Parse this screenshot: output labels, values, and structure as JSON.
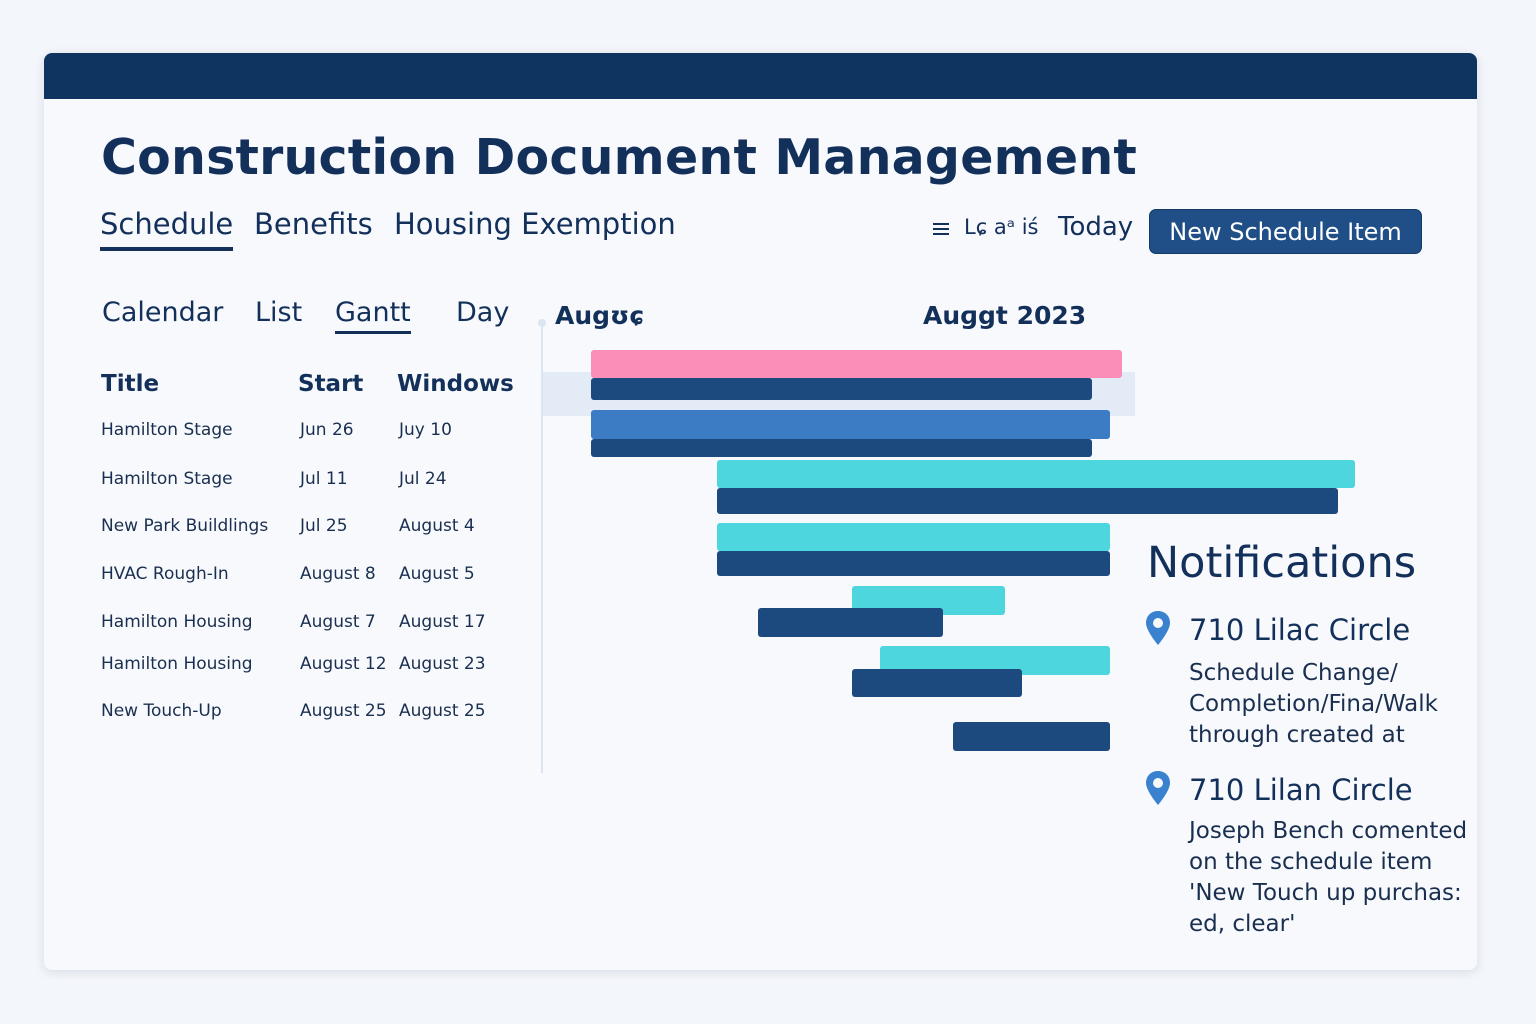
{
  "app": {
    "title": "Construction Document Management",
    "colors": {
      "header": "#0f3460",
      "accent": "#1f4f86",
      "pink": "#fb8eb8",
      "blue": "#3b7cc4",
      "cyan": "#4dd6de",
      "navy": "#1d4a7e"
    }
  },
  "main_tabs": [
    {
      "label": "Schedule",
      "active": true
    },
    {
      "label": "Benefits",
      "active": false
    },
    {
      "label": "Housing Exemption",
      "active": false
    }
  ],
  "toolbar": {
    "list_icon": "list-icon",
    "legend_label": "Lɕ aᵃ iś",
    "today_label": "Today",
    "new_item_label": "New Schedule Item"
  },
  "view_tabs": [
    {
      "label": "Calendar",
      "active": false
    },
    {
      "label": "List",
      "active": false
    },
    {
      "label": "Gantt",
      "active": true
    },
    {
      "label": "Day",
      "active": false
    }
  ],
  "table": {
    "columns": [
      "Title",
      "Start",
      "Windows"
    ],
    "rows": [
      {
        "title": "Hamilton Stage",
        "start": "Jun 26",
        "end": "Juy 10"
      },
      {
        "title": "Hamilton Stage",
        "start": "Jul 11",
        "end": "Jul 24"
      },
      {
        "title": "New Park Buildlings",
        "start": "Jul 25",
        "end": "August 4"
      },
      {
        "title": "HVAC Rough-In",
        "start": "August 8",
        "end": "August 5"
      },
      {
        "title": "Hamilton Housing",
        "start": "August 7",
        "end": "August 17"
      },
      {
        "title": "Hamilton Housing",
        "start": "August 12",
        "end": "August 23"
      },
      {
        "title": "New Touch-Up",
        "start": "August 25",
        "end": "August 25"
      }
    ]
  },
  "gantt": {
    "month_labels": [
      "Augʊɕ",
      "Auɡgt 2023"
    ],
    "bars": [
      {
        "color": "pink"
      },
      {
        "color": "navy"
      },
      {
        "color": "blue"
      },
      {
        "color": "navy"
      },
      {
        "color": "cyan"
      },
      {
        "color": "navy"
      },
      {
        "color": "cyan"
      },
      {
        "color": "navy"
      },
      {
        "color": "cyan"
      },
      {
        "color": "navy"
      },
      {
        "color": "cyan"
      },
      {
        "color": "navy"
      },
      {
        "color": "navy"
      }
    ]
  },
  "notifications": {
    "title": "Notifications",
    "items": [
      {
        "icon": "location-pin-icon",
        "heading": "710 Lilac Circle",
        "body": "Schedule Change/ Completion/Fina/Walk through created at"
      },
      {
        "icon": "location-pin-icon",
        "heading": "710 Lilan Circle",
        "body": "Joseph Bench comented on the schedule item 'New Touch up purchas: ed, clear'"
      }
    ]
  }
}
